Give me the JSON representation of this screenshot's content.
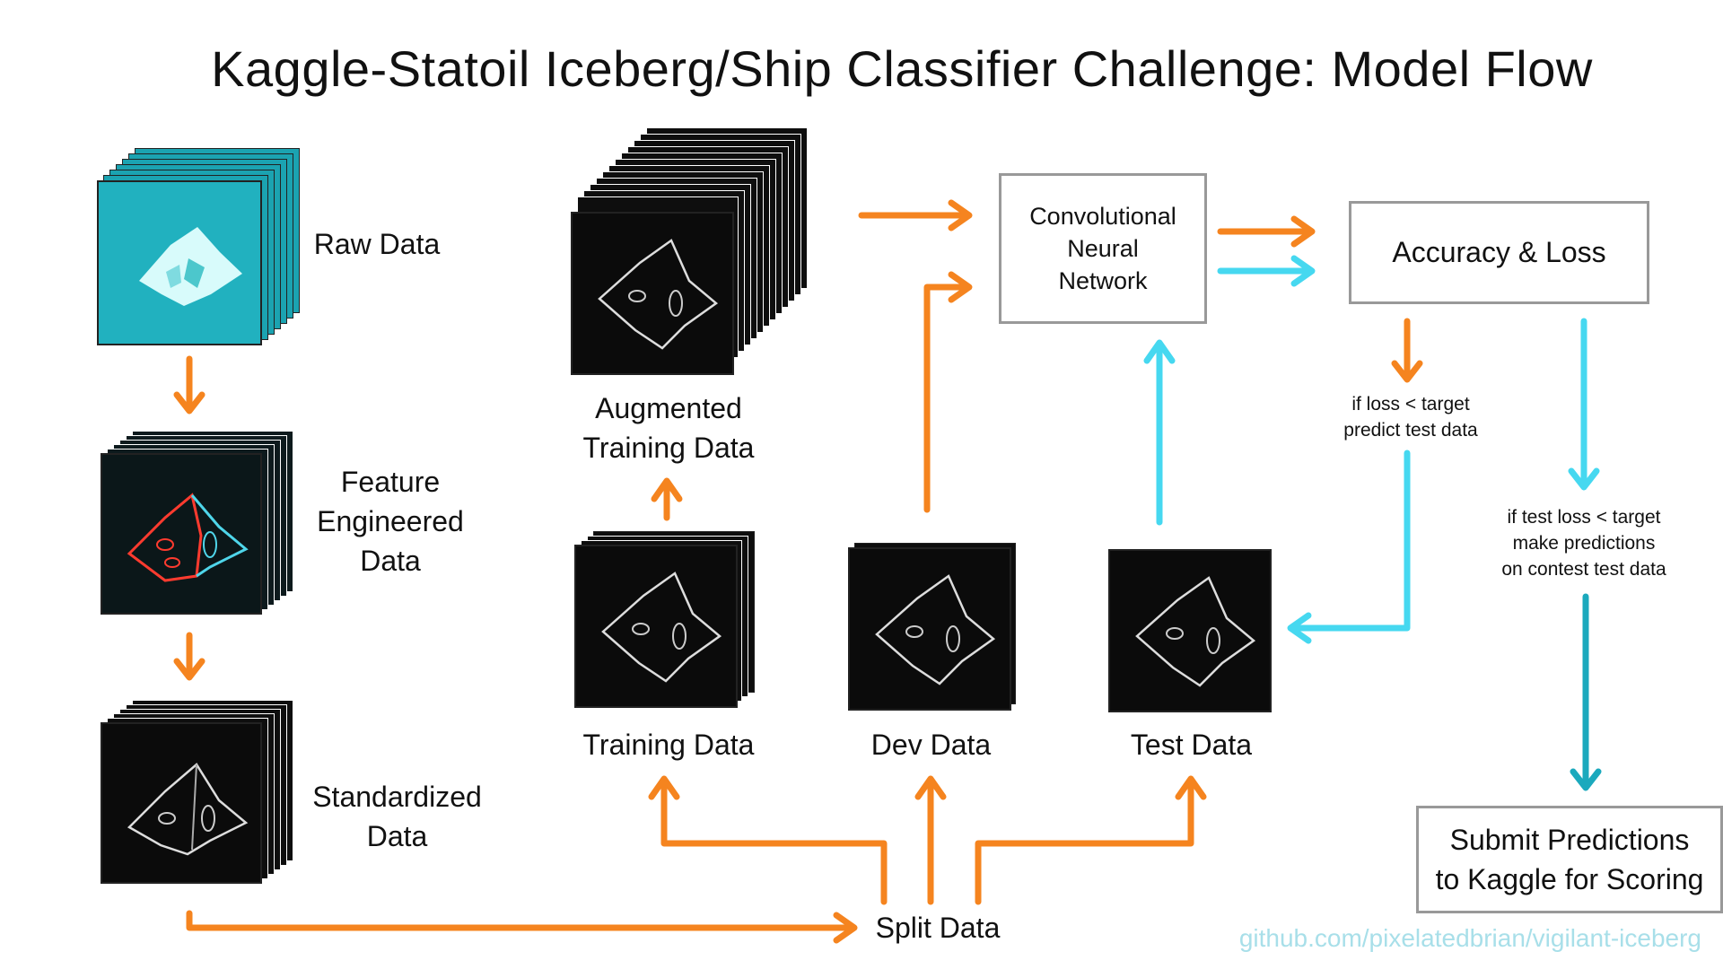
{
  "title": "Kaggle-Statoil Iceberg/Ship Classifier Challenge: Model Flow",
  "nodes": {
    "raw_data": "Raw Data",
    "feature_engineered_l1": "Feature",
    "feature_engineered_l2": "Engineered",
    "feature_engineered_l3": "Data",
    "standardized_l1": "Standardized",
    "standardized_l2": "Data",
    "augmented_l1": "Augmented",
    "augmented_l2": "Training Data",
    "training_data": "Training Data",
    "dev_data": "Dev Data",
    "test_data": "Test Data",
    "split_data": "Split Data",
    "cnn_l1": "Convolutional",
    "cnn_l2": "Neural",
    "cnn_l3": "Network",
    "accuracy_loss": "Accuracy & Loss",
    "submit_l1": "Submit Predictions",
    "submit_l2": "to Kaggle for Scoring"
  },
  "conditions": {
    "loss_l1": "if loss < target",
    "loss_l2": "predict test data",
    "test_l1": "if test loss < target",
    "test_l2": "make predictions",
    "test_l3": "on contest test data"
  },
  "footer": {
    "github": "github.com/pixelatedbrian/vigilant-iceberg"
  },
  "colors": {
    "orange": "#f5841f",
    "cyan": "#46d8f0",
    "teal": "#1ba9bd",
    "box_border": "#999999"
  }
}
